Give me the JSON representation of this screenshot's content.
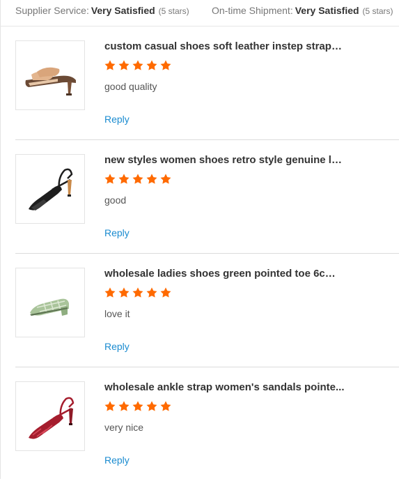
{
  "header": {
    "supplier_service": {
      "label": "Supplier Service:",
      "value": "Very Satisfied",
      "count": "(5 stars)"
    },
    "ontime_shipment": {
      "label": "On-time Shipment:",
      "value": "Very Satisfied",
      "count": "(5 stars)"
    }
  },
  "colors": {
    "star": "#ff6a00",
    "link": "#1a8bd0",
    "divider": "#dcdcdc"
  },
  "reviews": [
    {
      "title": "custom casual shoes soft leather instep straps...",
      "rating": 5,
      "comment": "good quality",
      "reply_label": "Reply",
      "image_icon": "beige-strap-slide-sandal-icon"
    },
    {
      "title": "new styles women shoes retro style genuine le...",
      "rating": 5,
      "comment": "good",
      "reply_label": "Reply",
      "image_icon": "black-slingback-heel-icon"
    },
    {
      "title": "wholesale ladies shoes green pointed toe 6cm ...",
      "rating": 5,
      "comment": "love it",
      "reply_label": "Reply",
      "image_icon": "green-plaid-mule-icon"
    },
    {
      "title": "wholesale ankle strap women's sandals pointe...",
      "rating": 5,
      "comment": "very nice",
      "reply_label": "Reply",
      "image_icon": "red-ankle-strap-heel-icon"
    }
  ]
}
